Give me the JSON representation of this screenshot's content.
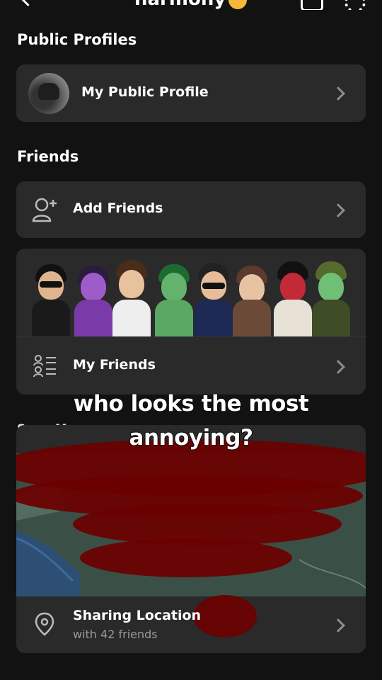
{
  "header": {
    "title_partial": "narmony",
    "back_icon": "chevron-left-icon",
    "right_icons": [
      "inbox-icon",
      "gear-icon"
    ]
  },
  "public_profiles": {
    "section_title": "Public Profiles",
    "row_label": "My Public Profile"
  },
  "friends": {
    "section_title": "Friends",
    "add_friends_label": "Add Friends",
    "my_friends_label": "My Friends",
    "bitmoji_count": 8
  },
  "snap_map": {
    "section_title": "Snap Map",
    "location_title": "Sharing Location",
    "location_subtitle": "with 42 friends"
  },
  "overlay_caption": {
    "line1": "who looks the most",
    "line2": "annoying?"
  },
  "colors": {
    "background": "#121212",
    "card": "#2a2a2a",
    "chevron": "#8c8c8c",
    "scribble": "#6b0000"
  }
}
